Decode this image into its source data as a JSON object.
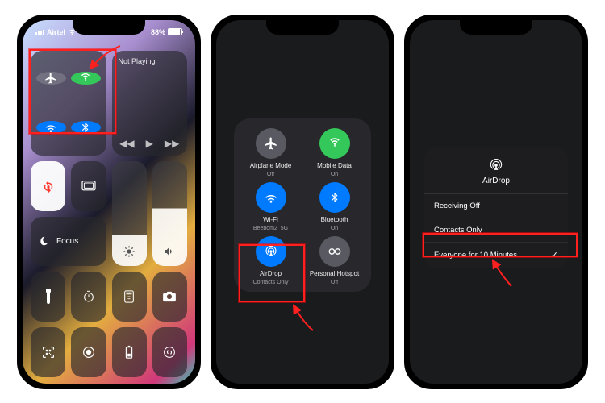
{
  "status": {
    "carrier": "Airtel",
    "battery_pct": "88%"
  },
  "phone1": {
    "media_title": "Not Playing",
    "focus_label": "Focus"
  },
  "phone2": {
    "cells": [
      {
        "label": "Airplane Mode",
        "sub": "Off"
      },
      {
        "label": "Mobile Data",
        "sub": "On"
      },
      {
        "label": "Wi-Fi",
        "sub": "Beebom2_5G"
      },
      {
        "label": "Bluetooth",
        "sub": "On"
      },
      {
        "label": "AirDrop",
        "sub": "Contacts Only"
      },
      {
        "label": "Personal Hotspot",
        "sub": "Off"
      }
    ]
  },
  "phone3": {
    "title": "AirDrop",
    "rows": [
      "Receiving Off",
      "Contacts Only",
      "Everyone for 10 Minutes"
    ],
    "selected_index": 2
  },
  "colors": {
    "green": "#34c759",
    "blue": "#007aff",
    "red": "#ff2020"
  }
}
